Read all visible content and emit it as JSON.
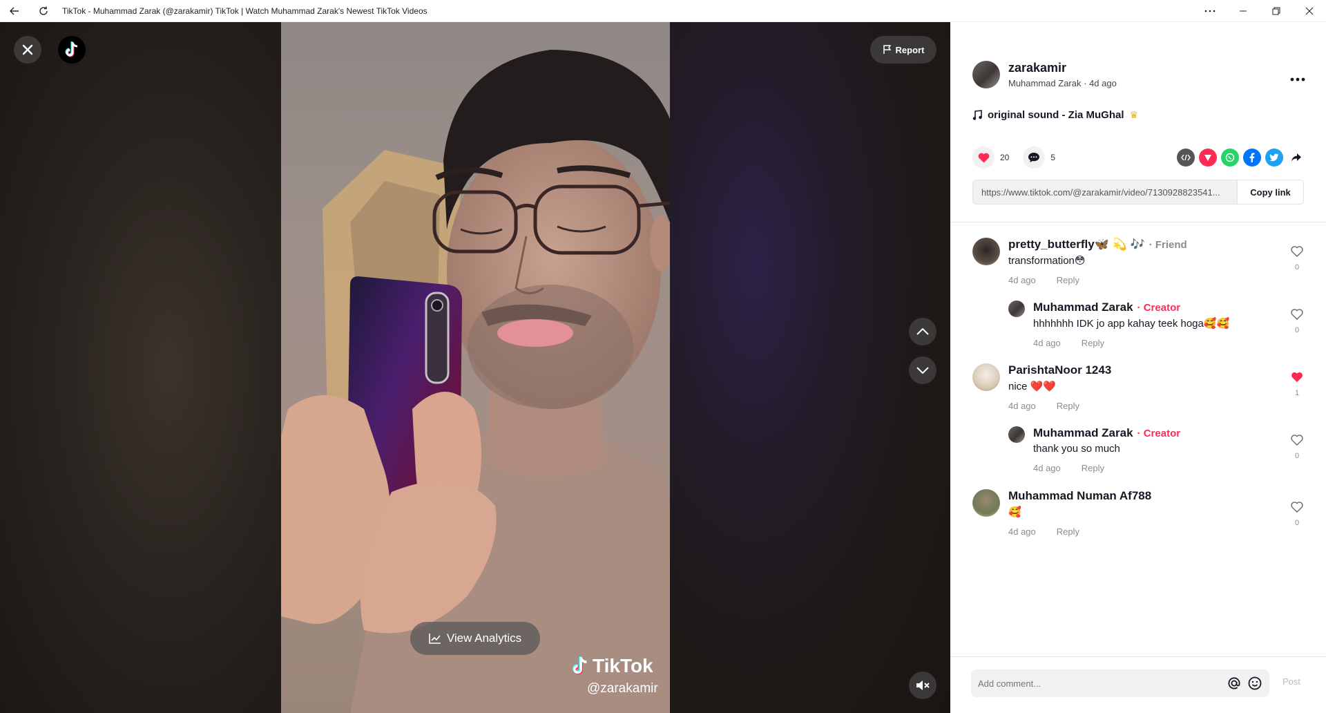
{
  "window": {
    "title": "TikTok - Muhammad Zarak (@zarakamir) TikTok | Watch Muhammad Zarak's Newest TikTok Videos"
  },
  "video": {
    "report_label": "Report",
    "analytics_label": "View Analytics",
    "watermark_brand": "TikTok",
    "watermark_handle": "@zarakamir"
  },
  "post": {
    "username": "zarakamir",
    "display_name": "Muhammad Zarak",
    "age": "4d ago",
    "sound": "original sound - Zia MuGhal",
    "likes": "20",
    "comments_count": "5",
    "link": "https://www.tiktok.com/@zarakamir/video/7130928823541...",
    "copy_label": "Copy link"
  },
  "comments": [
    {
      "name": "pretty_butterfly🦋 💫 🎶",
      "tag": "Friend",
      "text": "transformation😳",
      "time": "4d ago",
      "reply": "Reply",
      "likes": "0",
      "liked": false
    },
    {
      "name": "Muhammad Zarak",
      "tag": "Creator",
      "text": "hhhhhhh IDK jo app kahay teek hoga🥰🥰",
      "time": "4d ago",
      "reply": "Reply",
      "likes": "0",
      "liked": false
    },
    {
      "name": "ParishtaNoor 1243",
      "tag": "",
      "text": "nice ❤️❤️",
      "time": "4d ago",
      "reply": "Reply",
      "likes": "1",
      "liked": true
    },
    {
      "name": "Muhammad Zarak",
      "tag": "Creator",
      "text": "thank you so much",
      "time": "4d ago",
      "reply": "Reply",
      "likes": "0",
      "liked": false
    },
    {
      "name": "Muhammad Numan Af788",
      "tag": "",
      "text": "🥰",
      "time": "4d ago",
      "reply": "Reply",
      "likes": "0",
      "liked": false
    }
  ],
  "composer": {
    "placeholder": "Add comment...",
    "post_label": "Post"
  },
  "colors": {
    "accent": "#fe2c55",
    "muted": "#8a8b91"
  }
}
